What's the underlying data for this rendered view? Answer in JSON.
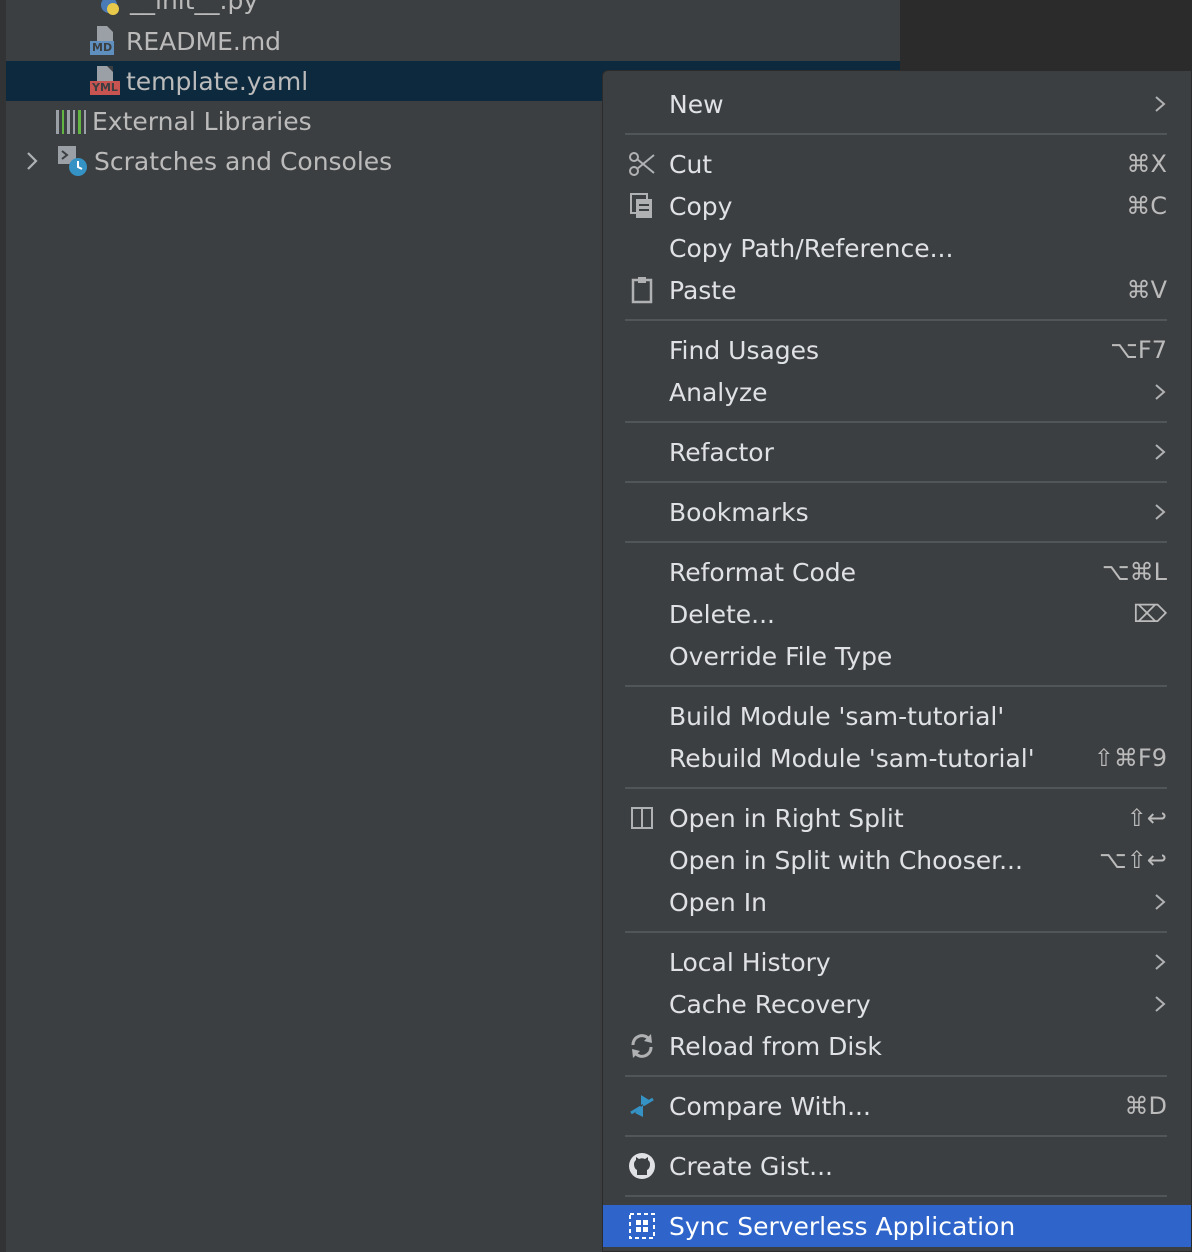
{
  "project_tree": {
    "items": [
      {
        "label": "__init__.py"
      },
      {
        "label": "README.md",
        "icon_tag": "MD"
      },
      {
        "label": "template.yaml",
        "icon_tag": "YML"
      },
      {
        "label": "External Libraries"
      },
      {
        "label": "Scratches and Consoles"
      }
    ]
  },
  "menu": {
    "new": {
      "label": "New"
    },
    "cut": {
      "label": "Cut",
      "shortcut": "⌘X"
    },
    "copy": {
      "label": "Copy",
      "shortcut": "⌘C"
    },
    "copy_path": {
      "label": "Copy Path/Reference..."
    },
    "paste": {
      "label": "Paste",
      "shortcut": "⌘V"
    },
    "find_usages": {
      "label": "Find Usages",
      "shortcut": "⌥F7"
    },
    "analyze": {
      "label": "Analyze"
    },
    "refactor": {
      "label": "Refactor"
    },
    "bookmarks": {
      "label": "Bookmarks"
    },
    "reformat": {
      "label": "Reformat Code",
      "shortcut": "⌥⌘L"
    },
    "delete": {
      "label": "Delete...",
      "shortcut": "⌦"
    },
    "override_type": {
      "label": "Override File Type"
    },
    "build_module": {
      "label": "Build Module 'sam-tutorial'"
    },
    "rebuild_module": {
      "label": "Rebuild Module 'sam-tutorial'",
      "shortcut": "⇧⌘F9"
    },
    "open_right_split": {
      "label": "Open in Right Split",
      "shortcut": "⇧↩"
    },
    "open_split_chooser": {
      "label": "Open in Split with Chooser...",
      "shortcut": "⌥⇧↩"
    },
    "open_in": {
      "label": "Open In"
    },
    "local_history": {
      "label": "Local History"
    },
    "cache_recovery": {
      "label": "Cache Recovery"
    },
    "reload_disk": {
      "label": "Reload from Disk"
    },
    "compare_with": {
      "label": "Compare With...",
      "shortcut": "⌘D"
    },
    "create_gist": {
      "label": "Create Gist..."
    },
    "sync_serverless": {
      "label": "Sync Serverless Application"
    }
  },
  "colors": {
    "panel_bg": "#3c3f41",
    "selection_bg": "#0d293e",
    "highlight_bg": "#2f65ca",
    "text": "#dfe1e5"
  }
}
